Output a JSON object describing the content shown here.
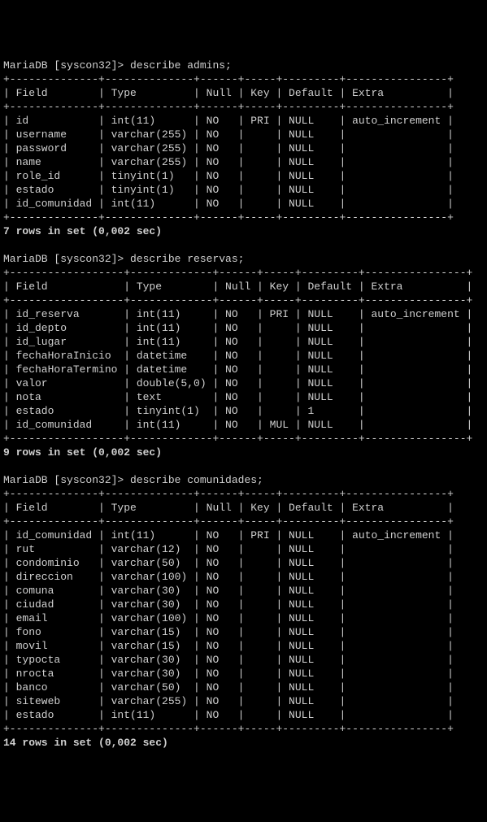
{
  "prompt_prefix": "MariaDB [syscon32]> ",
  "cmd1": "describe admins;",
  "cmd2": "describe reservas;",
  "cmd3": "describe comunidades;",
  "summary1": "7 rows in set (0,002 sec)",
  "summary2": "9 rows in set (0,002 sec)",
  "summary3": "14 rows in set (0,002 sec)",
  "headers": [
    "Field",
    "Type",
    "Null",
    "Key",
    "Default",
    "Extra"
  ],
  "table1": {
    "sep": "+--------------+--------------+------+-----+---------+----------------+",
    "header_row": "| Field        | Type         | Null | Key | Default | Extra          |",
    "rows": [
      "| id           | int(11)      | NO   | PRI | NULL    | auto_increment |",
      "| username     | varchar(255) | NO   |     | NULL    |                |",
      "| password     | varchar(255) | NO   |     | NULL    |                |",
      "| name         | varchar(255) | NO   |     | NULL    |                |",
      "| role_id      | tinyint(1)   | NO   |     | NULL    |                |",
      "| estado       | tinyint(1)   | NO   |     | NULL    |                |",
      "| id_comunidad | int(11)      | NO   |     | NULL    |                |"
    ]
  },
  "table2": {
    "sep": "+------------------+-------------+------+-----+---------+----------------+",
    "header_row": "| Field            | Type        | Null | Key | Default | Extra          |",
    "rows": [
      "| id_reserva       | int(11)     | NO   | PRI | NULL    | auto_increment |",
      "| id_depto         | int(11)     | NO   |     | NULL    |                |",
      "| id_lugar         | int(11)     | NO   |     | NULL    |                |",
      "| fechaHoraInicio  | datetime    | NO   |     | NULL    |                |",
      "| fechaHoraTermino | datetime    | NO   |     | NULL    |                |",
      "| valor            | double(5,0) | NO   |     | NULL    |                |",
      "| nota             | text        | NO   |     | NULL    |                |",
      "| estado           | tinyint(1)  | NO   |     | 1       |                |",
      "| id_comunidad     | int(11)     | NO   | MUL | NULL    |                |"
    ]
  },
  "table3": {
    "sep": "+--------------+--------------+------+-----+---------+----------------+",
    "header_row": "| Field        | Type         | Null | Key | Default | Extra          |",
    "rows": [
      "| id_comunidad | int(11)      | NO   | PRI | NULL    | auto_increment |",
      "| rut          | varchar(12)  | NO   |     | NULL    |                |",
      "| condominio   | varchar(50)  | NO   |     | NULL    |                |",
      "| direccion    | varchar(100) | NO   |     | NULL    |                |",
      "| comuna       | varchar(30)  | NO   |     | NULL    |                |",
      "| ciudad       | varchar(30)  | NO   |     | NULL    |                |",
      "| email        | varchar(100) | NO   |     | NULL    |                |",
      "| fono         | varchar(15)  | NO   |     | NULL    |                |",
      "| movil        | varchar(15)  | NO   |     | NULL    |                |",
      "| typocta      | varchar(30)  | NO   |     | NULL    |                |",
      "| nrocta       | varchar(30)  | NO   |     | NULL    |                |",
      "| banco        | varchar(50)  | NO   |     | NULL    |                |",
      "| siteweb      | varchar(255) | NO   |     | NULL    |                |",
      "| estado       | int(11)      | NO   |     | NULL    |                |"
    ]
  }
}
